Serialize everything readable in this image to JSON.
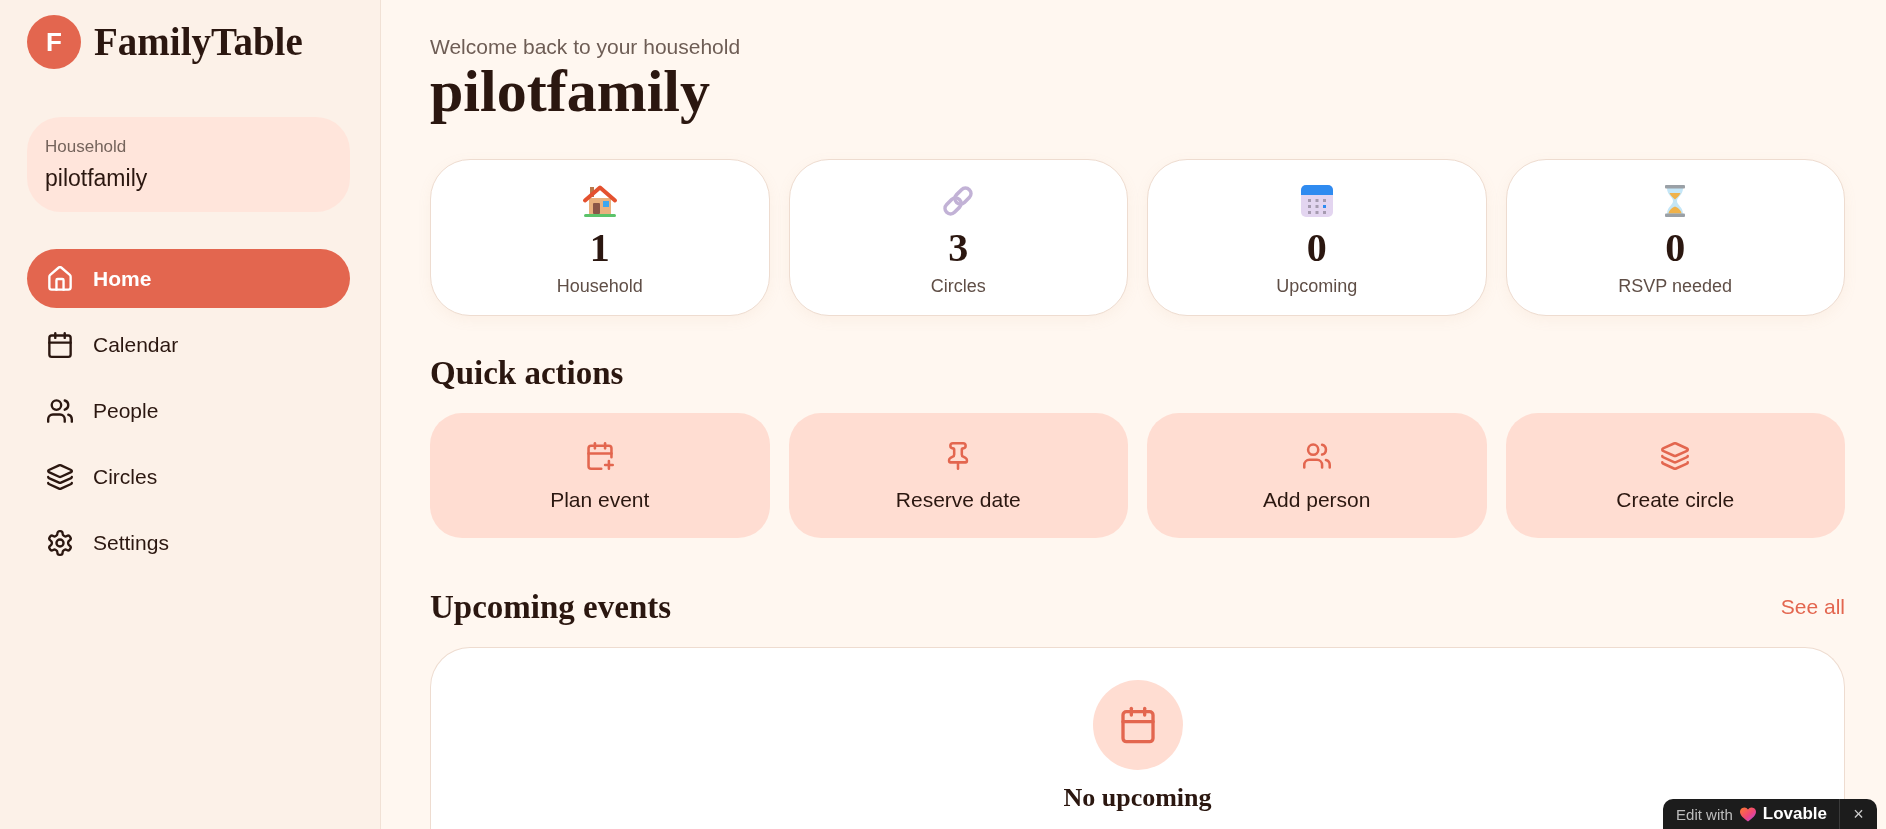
{
  "sidebar": {
    "logo": {
      "initial": "F",
      "name": "FamilyTable"
    },
    "household": {
      "label": "Household",
      "name": "pilotfamily"
    },
    "nav": [
      {
        "label": "Home",
        "selected": true
      },
      {
        "label": "Calendar",
        "selected": false
      },
      {
        "label": "People",
        "selected": false
      },
      {
        "label": "Circles",
        "selected": false
      },
      {
        "label": "Settings",
        "selected": false
      }
    ]
  },
  "header": {
    "subtitle": "Welcome back to your household",
    "title": "pilotfamily"
  },
  "stats": [
    {
      "value": "1",
      "label": "Household"
    },
    {
      "value": "3",
      "label": "Circles"
    },
    {
      "value": "0",
      "label": "Upcoming"
    },
    {
      "value": "0",
      "label": "RSVP needed"
    }
  ],
  "quick_actions": {
    "title": "Quick actions",
    "items": [
      {
        "label": "Plan event"
      },
      {
        "label": "Reserve date"
      },
      {
        "label": "Add person"
      },
      {
        "label": "Create circle"
      }
    ]
  },
  "upcoming_events": {
    "title": "Upcoming events",
    "link": "See all",
    "empty_state": {
      "title": "No upcoming"
    }
  },
  "badge": {
    "label": "Edit with",
    "brand": "Lovable",
    "close": "×"
  }
}
